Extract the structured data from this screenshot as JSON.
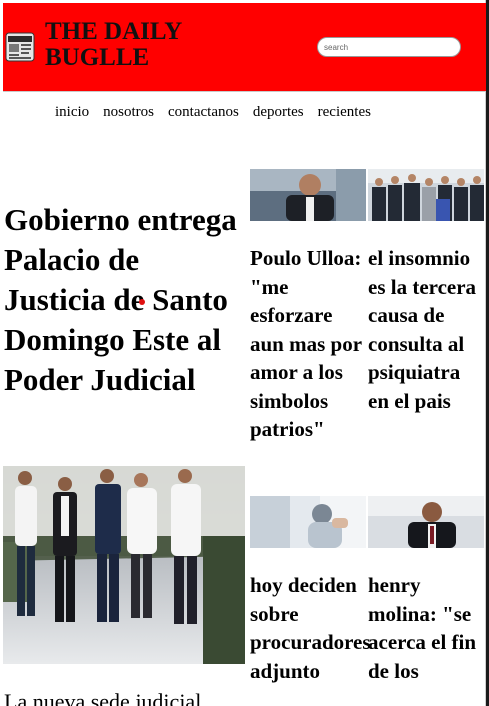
{
  "header": {
    "title": "THE DAILY BUGLLE",
    "logo_icon": "newspaper-logo-icon",
    "search_placeholder": "search",
    "background_color": "#ff0000"
  },
  "nav": {
    "items": [
      {
        "label": "inicio"
      },
      {
        "label": "nosotros"
      },
      {
        "label": "contactanos"
      },
      {
        "label": "deportes"
      },
      {
        "label": "recientes"
      }
    ]
  },
  "main_article": {
    "headline": "Gobierno entrega Palacio de Justicia de Santo Domingo Este al Poder Judicial",
    "summary": "La nueva sede judicial"
  },
  "stories": [
    {
      "title": "Poulo Ulloa: \"me esforzare aun mas por amor a los simbolos patrios\""
    },
    {
      "title": "el insomnio es la tercera causa de consulta al psiquiatra en el pais"
    },
    {
      "title": "hoy deciden sobre procuradores adjunto"
    },
    {
      "title": "henry molina: \"se acerca el fin de los"
    }
  ]
}
